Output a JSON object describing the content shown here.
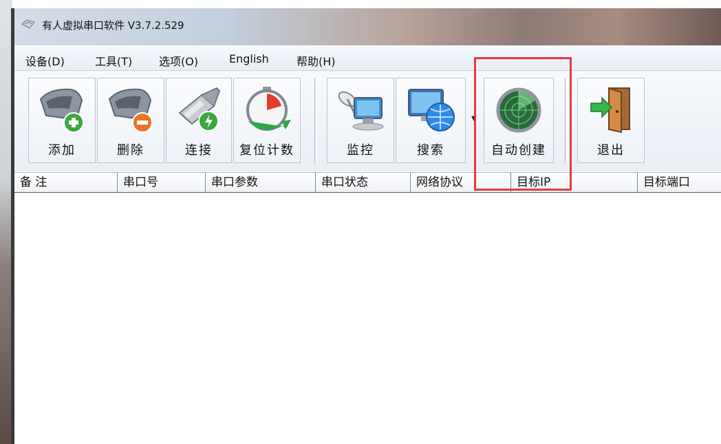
{
  "window": {
    "title": "有人虚拟串口软件 V3.7.2.529"
  },
  "menu": [
    {
      "label": "设备(D)"
    },
    {
      "label": "工具(T)"
    },
    {
      "label": "选项(O)"
    },
    {
      "label": "English"
    },
    {
      "label": "帮助(H)"
    }
  ],
  "toolbar": {
    "add": "添加",
    "delete": "删除",
    "connect": "连接",
    "reset_count": "复位计数",
    "monitor": "监控",
    "search": "搜索",
    "auto_create": "自动创建",
    "exit": "退出"
  },
  "columns": [
    "备 注",
    "串口号",
    "串口参数",
    "串口状态",
    "网络协议",
    "目标IP",
    "目标端口"
  ],
  "colors": {
    "highlight": "#e8393f",
    "add_badge": "#3aa640",
    "delete_badge": "#e8742a",
    "connect_badge": "#3aa640"
  },
  "icons": {
    "add": "serial-port-add-icon",
    "delete": "serial-port-delete-icon",
    "connect": "ethernet-plug-icon",
    "reset_count": "stopwatch-reset-icon",
    "monitor": "satellite-monitor-icon",
    "search": "network-globe-search-icon",
    "auto_create": "radar-icon",
    "exit": "exit-door-icon"
  }
}
